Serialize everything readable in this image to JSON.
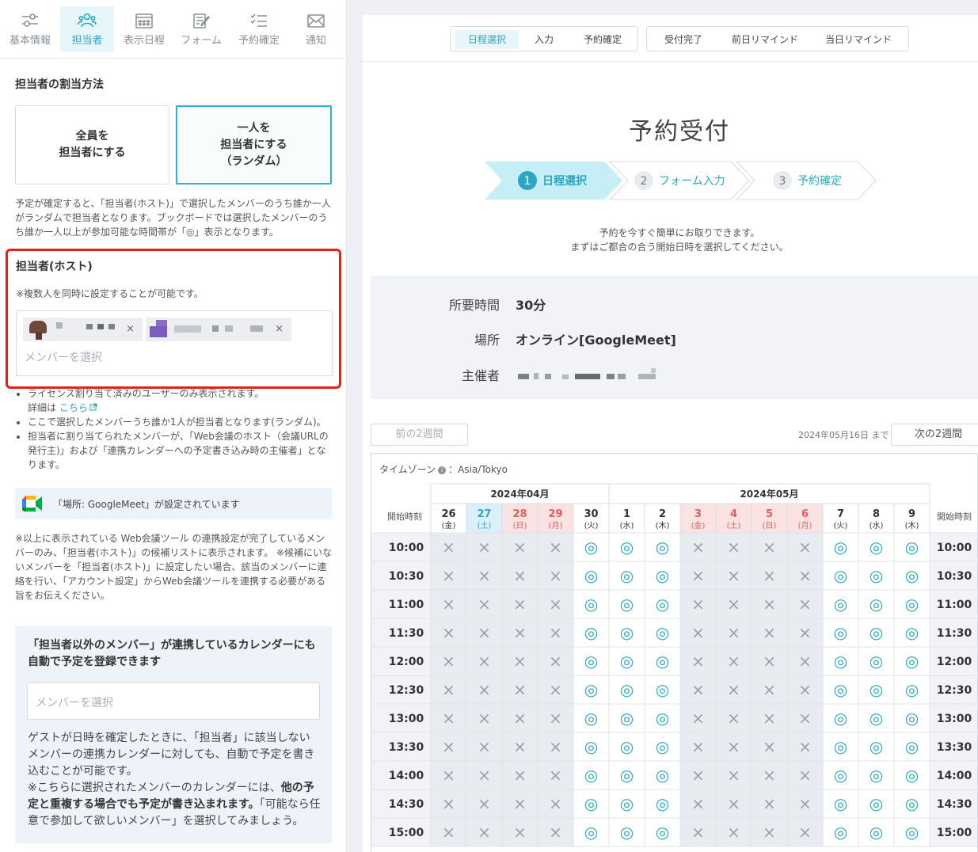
{
  "left_panel": {
    "tabs": [
      {
        "label": "基本情報",
        "icon": "sliders-icon",
        "active": false
      },
      {
        "label": "担当者",
        "icon": "users-icon",
        "active": true
      },
      {
        "label": "表示日程",
        "icon": "calendar-icon",
        "active": false
      },
      {
        "label": "フォーム",
        "icon": "form-edit-icon",
        "active": false
      },
      {
        "label": "予約確定",
        "icon": "checklist-icon",
        "active": false
      },
      {
        "label": "通知",
        "icon": "mail-icon",
        "active": false
      }
    ],
    "assign_title": "担当者の割当方法",
    "assign_options": [
      {
        "line1": "全員を",
        "line2": "担当者にする",
        "line3": "",
        "active": false
      },
      {
        "line1": "一人を",
        "line2": "担当者にする",
        "line3": "（ランダム）",
        "active": true
      }
    ],
    "assign_desc": "予定が確定すると、「担当者(ホスト)」で選択したメンバーのうち誰か一人がランダムで担当者となります。ブックボードでは選択したメンバーのうち誰か一人以上が参加可能な時間帯が「◎」表示となります。",
    "host": {
      "title": "担当者(ホスト)",
      "note": "※複数人を同時に設定することが可能です。",
      "chip_remove_symbol": "×",
      "placeholder": "メンバーを選択"
    },
    "bullets": {
      "b1": "ライセンス割り当て済みのユーザーのみ表示されます。",
      "b1_detail_prefix": "詳細は",
      "b1_link": "こちら",
      "b2": "ここで選択したメンバーうち誰か1人が担当者となります(ランダム)。",
      "b3": "担当者に割り当てられたメンバーが、「Web会議のホスト（会議URLの発行主)」および「連携カレンダーへの予定書き込み時の主催者」となります。"
    },
    "googlemeet_notice": "「場所: GoogleMeet」が設定されています",
    "web_note": "※以上に表示されている Web会議ツール の連携設定が完了しているメンバーのみ、「担当者(ホスト)」の候補リストに表示されます。 ※候補にいないメンバーを「担当者(ホスト)」に設定したい場合、該当のメンバーに連絡を行い、「アカウント設定」からWeb会議ツールを連携する必要がある旨をお伝えください。",
    "other_members": {
      "title": "「担当者以外のメンバー」が連携しているカレンダーにも自動で予定を登録できます",
      "placeholder": "メンバーを選択",
      "desc1": "ゲストが日時を確定したときに、「担当者」に該当しないメンバーの連携カレンダーに対しても、自動で予定を書き込むことが可能です。",
      "desc2_prefix": "※こちらに選択されたメンバーのカレンダーには、",
      "desc2_bold": "他の予定と重複する場合でも予定が書き込まれます。",
      "desc2_suffix": "「可能なら任意で参加して欲しいメンバー」を選択してみましょう。"
    }
  },
  "preview": {
    "segment_left": [
      {
        "label": "日程選択",
        "active": true
      },
      {
        "label": "入力",
        "active": false
      },
      {
        "label": "予約確定",
        "active": false
      }
    ],
    "segment_right": [
      {
        "label": "受付完了",
        "active": false
      },
      {
        "label": "前日リマインド",
        "active": false
      },
      {
        "label": "当日リマインド",
        "active": false
      }
    ],
    "title": "予約受付",
    "steps": [
      {
        "num": "1",
        "label": "日程選択",
        "active": true
      },
      {
        "num": "2",
        "label": "フォーム入力",
        "active": false
      },
      {
        "num": "3",
        "label": "予約確定",
        "active": false
      }
    ],
    "intro_line1": "予約を今すぐ簡単にお取りできます。",
    "intro_line2": "まずはご都合の合う開始日時を選択してください。",
    "info": [
      {
        "label": "所要時間",
        "value": "30分"
      },
      {
        "label": "場所",
        "value": "オンライン[GoogleMeet]"
      },
      {
        "label": "主催者",
        "value": ""
      }
    ],
    "prev_button": "前の2週間",
    "next_button": "次の2週間",
    "until": "2024年05月16日 まで",
    "timezone_label": "タイムゾーン",
    "timezone_info_glyph": "i",
    "timezone_value": "：Asia/Tokyo",
    "time_header": "開始時刻",
    "symbols": {
      "available": "◎",
      "unavailable": "×"
    },
    "colors": {
      "accent": "#2aa7c6",
      "holiday": "#e35b5b",
      "today_bg": "#dcf0fb",
      "holiday_bg": "#fbe3e3",
      "unavail_bg": "#e8ecf0"
    },
    "months": [
      {
        "label": "2024年04月",
        "span": 5
      },
      {
        "label": "2024年05月",
        "span": 9
      }
    ],
    "days": [
      {
        "day": "26",
        "wd": "(金)",
        "kind": "normal"
      },
      {
        "day": "27",
        "wd": "(土)",
        "kind": "today"
      },
      {
        "day": "28",
        "wd": "(日)",
        "kind": "holiday"
      },
      {
        "day": "29",
        "wd": "(月)",
        "kind": "holiday"
      },
      {
        "day": "30",
        "wd": "(火)",
        "kind": "normal"
      },
      {
        "day": "1",
        "wd": "(水)",
        "kind": "normal"
      },
      {
        "day": "2",
        "wd": "(木)",
        "kind": "normal"
      },
      {
        "day": "3",
        "wd": "(金)",
        "kind": "holiday"
      },
      {
        "day": "4",
        "wd": "(土)",
        "kind": "holiday"
      },
      {
        "day": "5",
        "wd": "(日)",
        "kind": "holiday"
      },
      {
        "day": "6",
        "wd": "(月)",
        "kind": "holiday"
      },
      {
        "day": "7",
        "wd": "(火)",
        "kind": "normal"
      },
      {
        "day": "8",
        "wd": "(水)",
        "kind": "normal"
      },
      {
        "day": "9",
        "wd": "(木)",
        "kind": "normal"
      }
    ],
    "times": [
      "10:00",
      "10:30",
      "11:00",
      "11:30",
      "12:00",
      "12:30",
      "13:00",
      "13:30",
      "14:00",
      "14:30",
      "15:00"
    ],
    "availability_by_day": [
      false,
      false,
      false,
      false,
      true,
      true,
      true,
      false,
      false,
      false,
      false,
      true,
      true,
      true
    ]
  }
}
